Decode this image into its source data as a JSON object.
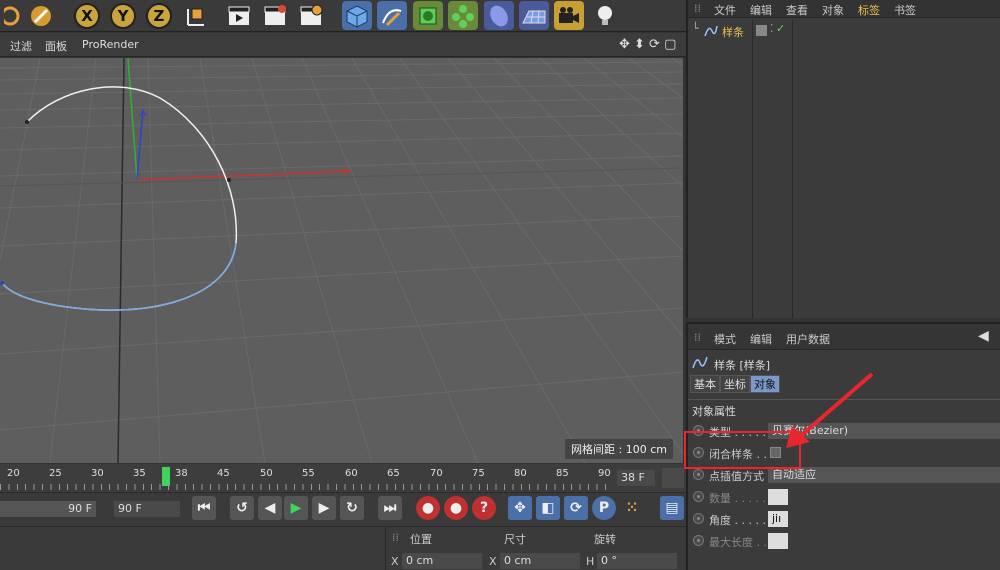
{
  "viewport": {
    "menu": [
      "过滤",
      "面板",
      "ProRender"
    ],
    "grid_info": "网格间距 : 100 cm"
  },
  "toolbar": {
    "axis_x": "X",
    "axis_y": "Y",
    "axis_z": "Z"
  },
  "timeline": {
    "ticks": [
      "20",
      "25",
      "30",
      "35",
      "38",
      "45",
      "50",
      "55",
      "60",
      "65",
      "70",
      "75",
      "80",
      "85",
      "90"
    ],
    "current_marker": "38",
    "current_frame": "38 F",
    "end_frame_field": "90 F",
    "end_frame": "90 F"
  },
  "coords": {
    "headers": {
      "position": "位置",
      "size": "尺寸",
      "rotation": "旋转"
    },
    "x_label": "X",
    "x_pos": "0 cm",
    "x_size_label": "X",
    "x_size": "0 cm",
    "h_label": "H",
    "h_rot": "0 °"
  },
  "object_manager": {
    "menu": [
      "文件",
      "编辑",
      "查看",
      "对象",
      "标签",
      "书签"
    ],
    "active_menu_color": "#e8c24a",
    "object_name": "样条",
    "check_color": "#6fcf5a"
  },
  "attributes": {
    "menu": [
      "模式",
      "编辑",
      "用户数据"
    ],
    "object_title": "样条 [样条]",
    "tabs": [
      "基本",
      "坐标",
      "对象"
    ],
    "active_tab": "对象",
    "section": "对象属性",
    "rows": [
      {
        "label": "类型 . . . . . .",
        "value": "贝赛尔(Bezier)"
      },
      {
        "label": "闭合样条 . . .",
        "value": ""
      },
      {
        "label": "点插值方式",
        "value": "自动适应"
      },
      {
        "label": "数量 . . . . .",
        "value": ""
      },
      {
        "label": "角度 . . . . .",
        "value": "jiı"
      },
      {
        "label": "最大长度 . .",
        "value": ""
      }
    ]
  },
  "annotation": {
    "color": "#e8262b"
  }
}
